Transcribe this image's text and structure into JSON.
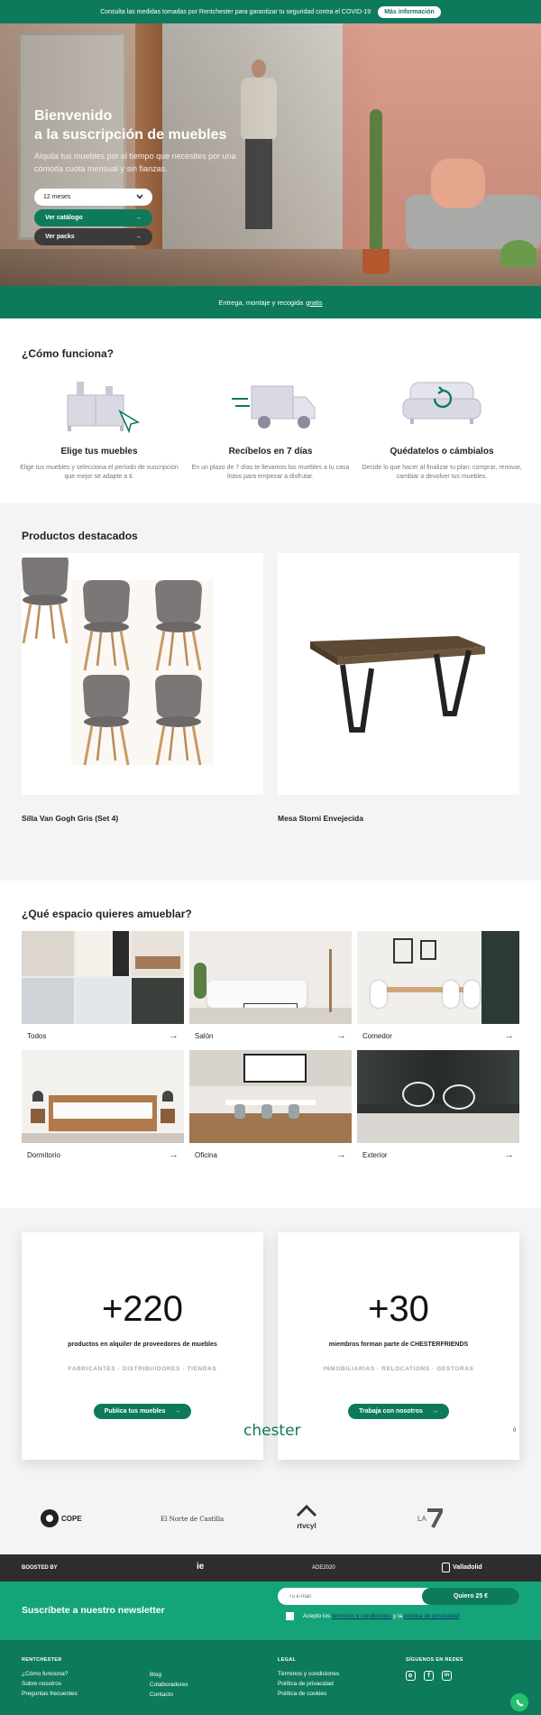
{
  "topbar": {
    "message": "Consulta las medidas tomadas por Rentchester para garantizar tu seguridad contra el COVID-19",
    "more_label": "Más información"
  },
  "hero": {
    "title_line1": "Bienvenido",
    "title_line2": "a la suscripción de muebles",
    "subtitle": "Alquila tus muebles por el tiempo que necesites por una cómoda cuota mensual y sin fianzas.",
    "duration_select": "12 meses",
    "catalog_button": "Ver catálogo",
    "packs_button": "Ver packs"
  },
  "delivery": {
    "text": "Entrega, montaje y recogida",
    "link": "gratis"
  },
  "how": {
    "title": "¿Cómo funciona?",
    "steps": [
      {
        "title": "Elige tus muebles",
        "text": "Elige tus muebles y selecciona el período de suscripción que mejor se adapte a ti."
      },
      {
        "title": "Recíbelos en 7 días",
        "text": "En un plazo de 7 días te llevamos los muebles a tu casa listos para empezar a disfrutar."
      },
      {
        "title": "Quédatelos o cámbialos",
        "text": "Decide lo que hacer al finalizar tu plan: comprar, renovar, cambiar o devolver tus muebles."
      }
    ]
  },
  "featured": {
    "title": "Productos destacados",
    "products": [
      {
        "name": "Silla Van Gogh Gris (Set 4)"
      },
      {
        "name": "Mesa Storni Envejecida"
      }
    ]
  },
  "spaces": {
    "title": "¿Qué espacio quieres amueblar?",
    "items": [
      {
        "label": "Todos"
      },
      {
        "label": "Salón"
      },
      {
        "label": "Comedor"
      },
      {
        "label": "Dormitorio"
      },
      {
        "label": "Oficina"
      },
      {
        "label": "Exterior"
      }
    ]
  },
  "stats": [
    {
      "number": "+220",
      "desc": "productos en alquiler de proveedores de muebles",
      "tags": "FABRICANTES · DISTRIBUIDORES · TIENDAS",
      "cta": "Publica tus muebles"
    },
    {
      "number": "+30",
      "desc": "miembros forman parte de CHESTERFRIENDS",
      "tags": "INMOBILIARIAS · RELOCATIONS · GESTORAS",
      "cta": "Trabaja con nosotros"
    }
  ],
  "brand_mark": "chester",
  "carousel_index": "0",
  "press": {
    "cope": "COPE",
    "norte": "El Norte de Castilla",
    "rtv": "rtvcyl",
    "la7": "LA"
  },
  "boosted": {
    "label": "BOOSTED BY",
    "ie": "ie",
    "ade": "ADE2020",
    "valladolid": "Valladolid"
  },
  "newsletter": {
    "title": "Suscríbete a nuestro newsletter",
    "email_placeholder": "Tu e-mail",
    "button": "Quiero 25 €",
    "consent_prefix": "Acepto los",
    "terms_link": "términos y condiciones",
    "consent_mid": "y la",
    "privacy_link": "política de privacidad"
  },
  "footer": {
    "col1": {
      "heading": "RENTCHESTER",
      "links": [
        "¿Cómo funciona?",
        "Sobre nosotros",
        "Preguntas frecuentes"
      ]
    },
    "col2": {
      "links": [
        "Blog",
        "Colaboradores",
        "Contacto"
      ]
    },
    "col3": {
      "heading": "LEGAL",
      "links": [
        "Términos y condiciones",
        "Política de privacidad",
        "Política de cookies"
      ]
    },
    "col4": {
      "heading": "SÍGUENOS EN REDES"
    }
  },
  "colors": {
    "brand_green": "#0e7a5c",
    "newsletter_green": "#15a37a",
    "dark": "#2e2d2d"
  }
}
